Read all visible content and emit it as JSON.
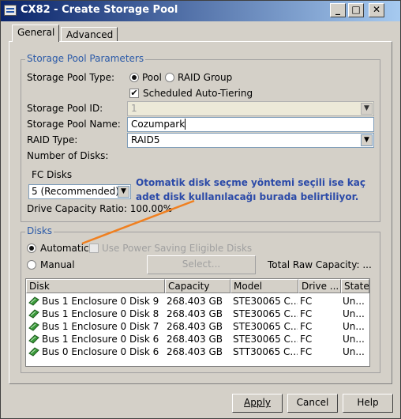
{
  "window": {
    "title": "CX82 - Create Storage Pool",
    "controls": {
      "minimize": "_",
      "maximize": "□",
      "close": "✕"
    }
  },
  "tabs": [
    {
      "label": "General",
      "active": true
    },
    {
      "label": "Advanced",
      "active": false
    }
  ],
  "params": {
    "legend": "Storage Pool Parameters",
    "type_label": "Storage Pool Type:",
    "type_pool": "Pool",
    "type_raid": "RAID Group",
    "type_selected": "Pool",
    "auto_tiering": "Scheduled Auto-Tiering",
    "auto_tiering_checked": true,
    "id_label": "Storage Pool ID:",
    "id_value": "1",
    "name_label": "Storage Pool Name:",
    "name_value": "Cozumpark",
    "raid_label": "RAID Type:",
    "raid_value": "RAID5",
    "num_disks_label": "Number of Disks:",
    "fc_label": "FC Disks",
    "fc_value": "5 (Recommended)",
    "capacity_ratio": "Drive Capacity Ratio: 100.00%"
  },
  "annotation": {
    "line1": "Otomatik disk seçme yöntemi seçili ise kaç",
    "line2": "adet disk kullanılacağı burada belirtiliyor.",
    "color": "#2b4aa8",
    "arrow_color": "#f08020"
  },
  "disks": {
    "legend": "Disks",
    "automatic": "Automatic",
    "manual": "Manual",
    "selected": "Automatic",
    "power_saving": "Use Power Saving Eligible Disks",
    "select_button": "Select...",
    "total_raw": "Total Raw Capacity: ...",
    "columns": [
      "Disk",
      "Capacity",
      "Model",
      "Drive ...",
      "State"
    ],
    "rows": [
      {
        "disk": "Bus 1 Enclosure 0 Disk 9",
        "capacity": "268.403 GB",
        "model": "STE30065 C...",
        "drive": "FC",
        "state": "Un..."
      },
      {
        "disk": "Bus 1 Enclosure 0 Disk 8",
        "capacity": "268.403 GB",
        "model": "STE30065 C...",
        "drive": "FC",
        "state": "Un..."
      },
      {
        "disk": "Bus 1 Enclosure 0 Disk 7",
        "capacity": "268.403 GB",
        "model": "STE30065 C...",
        "drive": "FC",
        "state": "Un..."
      },
      {
        "disk": "Bus 1 Enclosure 0 Disk 6",
        "capacity": "268.403 GB",
        "model": "STE30065 C...",
        "drive": "FC",
        "state": "Un..."
      },
      {
        "disk": "Bus 0 Enclosure 0 Disk 6",
        "capacity": "268.403 GB",
        "model": "STT30065 C...",
        "drive": "FC",
        "state": "Un..."
      }
    ]
  },
  "buttons": {
    "apply": "Apply",
    "cancel": "Cancel",
    "help": "Help"
  }
}
